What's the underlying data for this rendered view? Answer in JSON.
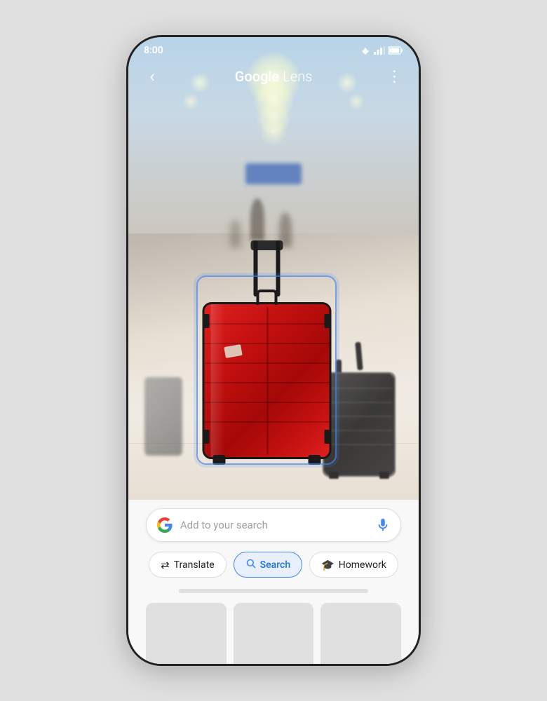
{
  "statusBar": {
    "time": "8:00"
  },
  "topBar": {
    "title": "Google Lens",
    "backLabel": "‹",
    "moreLabel": "⋮"
  },
  "searchBar": {
    "placeholder": "Add to your search"
  },
  "chips": [
    {
      "id": "translate",
      "label": "Translate",
      "icon": "⇄"
    },
    {
      "id": "search",
      "label": "Search",
      "icon": "🔍",
      "active": true
    },
    {
      "id": "homework",
      "label": "Homework",
      "icon": "🎓"
    }
  ],
  "colors": {
    "accent": "#4285f4",
    "google_red": "#ea4335",
    "google_blue": "#4285f4",
    "google_yellow": "#fbbc04",
    "google_green": "#34a853"
  }
}
